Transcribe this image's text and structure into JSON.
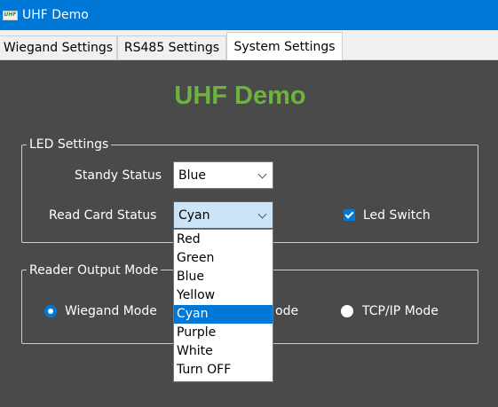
{
  "window": {
    "icon_text": "UHF",
    "title": "UHF Demo"
  },
  "tabs": [
    {
      "label": "Wiegand Settings",
      "active": false
    },
    {
      "label": "RS485 Settings",
      "active": false
    },
    {
      "label": "System Settings",
      "active": true
    }
  ],
  "logo": "UHF Demo",
  "led_settings": {
    "title": "LED Settings",
    "standy_label": "Standy Status",
    "standy_value": "Blue",
    "read_card_label": "Read Card Status",
    "read_card_value": "Cyan",
    "led_switch_label": "Led Switch",
    "led_switch_checked": true
  },
  "reader_output": {
    "title": "Reader Output Mode",
    "wiegand_label": "Wiegand Mode",
    "middle_label_visible": "ode",
    "tcpip_label": "TCP/IP Mode",
    "selected": "Wiegand Mode"
  },
  "dropdown": {
    "options": [
      "Red",
      "Green",
      "Blue",
      "Yellow",
      "Cyan",
      "Purple",
      "White",
      "Turn OFF"
    ],
    "selected": "Cyan"
  },
  "colors": {
    "titlebar": "#0078d7",
    "panel_bg": "#4a4a4a",
    "logo": "#6db33f",
    "accent": "#0078d7"
  }
}
